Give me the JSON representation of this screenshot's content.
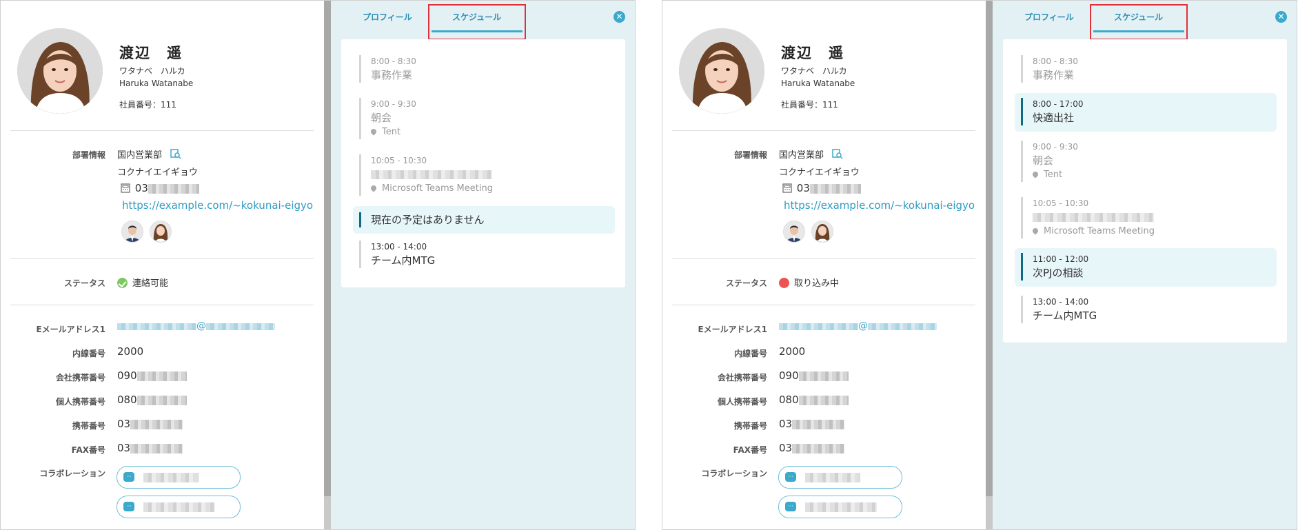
{
  "panel_a": {
    "profile": {
      "name": "渡辺　遥",
      "kana": "ワタナベ　ハルカ",
      "roman": "Haruka Watanabe",
      "employee_no": "社員番号：111",
      "dept_label": "部署情報",
      "dept_name": "国内営業部",
      "dept_kana": "コクナイエイギョウ",
      "dept_phone_prefix": "03",
      "dept_url": "https://example.com/~kokunai-eigyo",
      "status_label": "ステータス",
      "status_text": "連絡可能",
      "status_color": "#7dc862",
      "email_label": "Eメールアドレス1",
      "email_at": "@",
      "ext_label": "内線番号",
      "ext_value": "2000",
      "company_mobile_label": "会社携帯番号",
      "company_mobile_prefix": "090",
      "private_mobile_label": "個人携帯番号",
      "private_mobile_prefix": "080",
      "mobile_label": "携帯番号",
      "mobile_prefix": "03",
      "fax_label": "FAX番号",
      "fax_prefix": "03",
      "collab_label": "コラボレーション"
    },
    "tabs": {
      "profile": "プロフィール",
      "schedule": "スケジュール"
    },
    "events": [
      {
        "time": "8:00 - 8:30",
        "title": "事務作業"
      },
      {
        "time": "9:00 - 9:30",
        "title": "朝会",
        "location": "Tent"
      },
      {
        "time": "10:05 - 10:30",
        "location": "Microsoft Teams Meeting"
      },
      {
        "title": "現在の予定はありません"
      },
      {
        "time": "13:00 - 14:00",
        "title": "チーム内MTG"
      }
    ]
  },
  "panel_b": {
    "profile": {
      "name": "渡辺　遥",
      "kana": "ワタナベ　ハルカ",
      "roman": "Haruka Watanabe",
      "employee_no": "社員番号：111",
      "dept_label": "部署情報",
      "dept_name": "国内営業部",
      "dept_kana": "コクナイエイギョウ",
      "dept_phone_prefix": "03",
      "dept_url": "https://example.com/~kokunai-eigyo",
      "status_label": "ステータス",
      "status_text": "取り込み中",
      "status_color": "#ee5353",
      "email_label": "Eメールアドレス1",
      "email_at": "@",
      "ext_label": "内線番号",
      "ext_value": "2000",
      "company_mobile_label": "会社携帯番号",
      "company_mobile_prefix": "090",
      "private_mobile_label": "個人携帯番号",
      "private_mobile_prefix": "080",
      "mobile_label": "携帯番号",
      "mobile_prefix": "03",
      "fax_label": "FAX番号",
      "fax_prefix": "03",
      "collab_label": "コラボレーション"
    },
    "tabs": {
      "profile": "プロフィール",
      "schedule": "スケジュール"
    },
    "events": [
      {
        "time": "8:00 - 8:30",
        "title": "事務作業"
      },
      {
        "time": "8:00 - 17:00",
        "title": "快適出社"
      },
      {
        "time": "9:00 - 9:30",
        "title": "朝会",
        "location": "Tent"
      },
      {
        "time": "10:05 - 10:30",
        "location": "Microsoft Teams Meeting"
      },
      {
        "time": "11:00 - 12:00",
        "title": "次PJの相談"
      },
      {
        "time": "13:00 - 14:00",
        "title": "チーム内MTG"
      }
    ]
  }
}
